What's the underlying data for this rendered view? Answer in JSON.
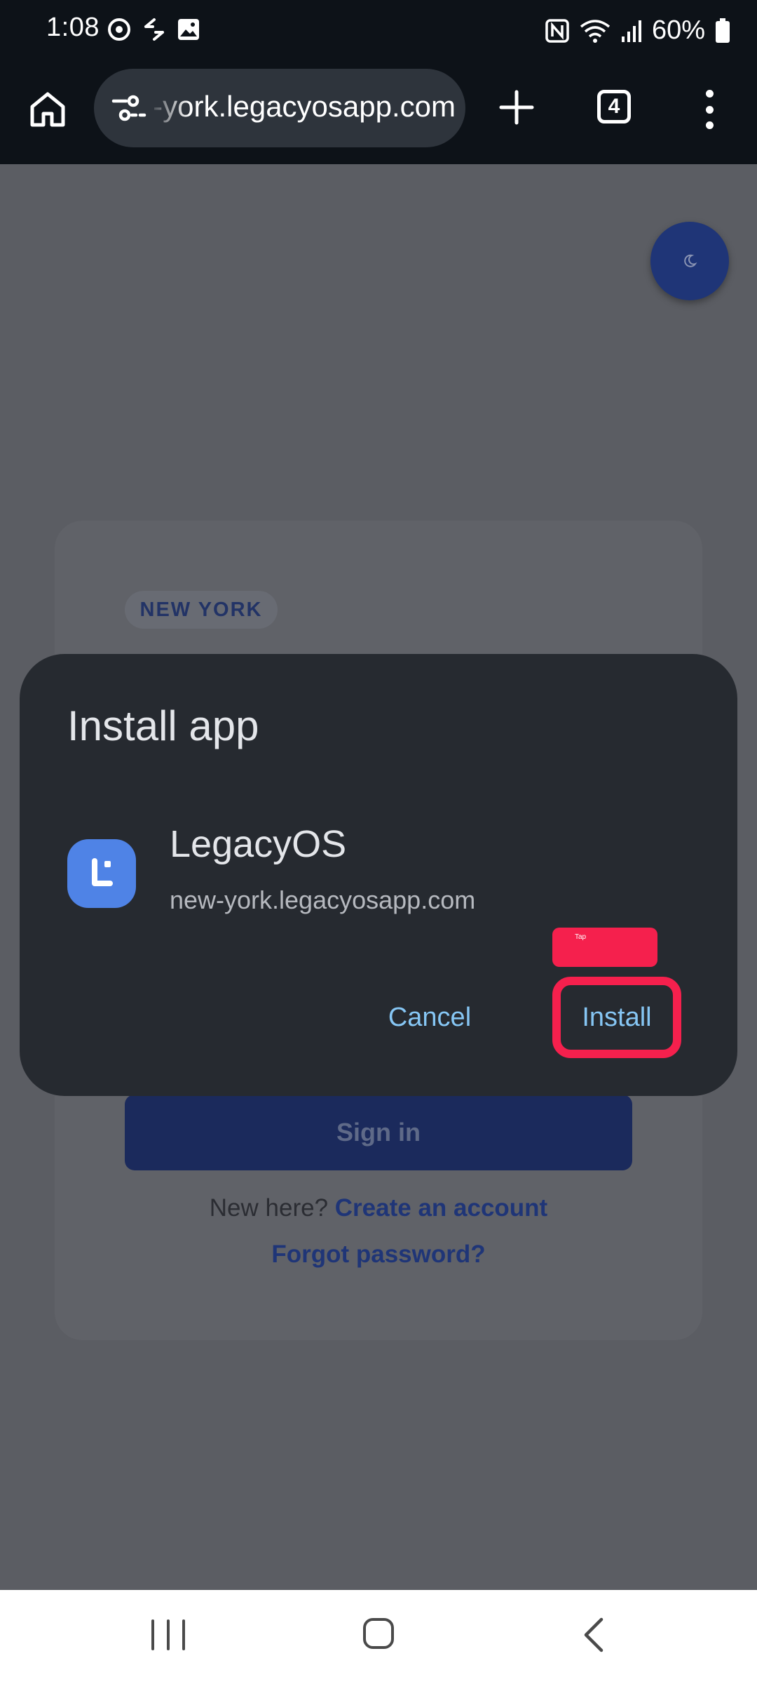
{
  "status_bar": {
    "time": "1:08",
    "battery": "60%",
    "icons": [
      "sync-icon",
      "transfer-icon",
      "gallery-icon",
      "nfc-icon",
      "wifi-icon",
      "signal-icon",
      "battery-icon"
    ]
  },
  "browser": {
    "url_display": "new-york.legacyosapp.com",
    "tab_count": "4",
    "icons": [
      "home-icon",
      "site-settings-icon",
      "new-tab-icon",
      "more-vert-icon"
    ]
  },
  "page": {
    "city_badge": "NEW YORK",
    "sign_in_label": "Sign in",
    "new_here_text": "New here?",
    "create_account_link": "Create an account",
    "forgot_password_link": "Forgot password?",
    "theme_toggle_icon": "moon-icon"
  },
  "install_dialog": {
    "title": "Install app",
    "app_name": "LegacyOS",
    "app_domain": "new-york.legacyosapp.com",
    "cancel_label": "Cancel",
    "install_label": "Install"
  },
  "annotation": {
    "tap_label": "Tap",
    "highlight_color": "#f5204d"
  },
  "colors": {
    "dialog_bg": "#262a30",
    "dialog_button_text": "#86c6f4",
    "app_icon_bg": "#4f83e6",
    "primary_blue": "#1f3577"
  }
}
